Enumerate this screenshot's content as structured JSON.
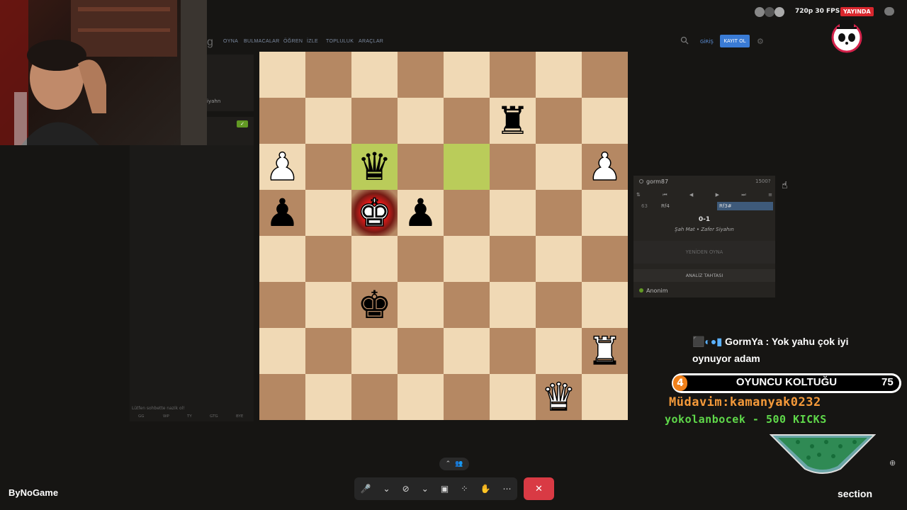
{
  "site": {
    "logo": "g",
    "nav": [
      "OYNA",
      "BULMACALAR",
      "ÖĞREN",
      "İZLE",
      "TOPLULUK",
      "ARAÇLAR"
    ],
    "login": "GİRİŞ",
    "signup": "KAYIT OL"
  },
  "left": {
    "partial_name": "iyahn",
    "chat_placeholder": "Lütfen sohbette nazik ol!",
    "chat_buttons": [
      "GG",
      "WP",
      "TY",
      "GTG",
      "BYE"
    ]
  },
  "board": {
    "squares": [
      [
        "",
        "",
        "",
        "",
        "",
        "",
        "",
        ""
      ],
      [
        "",
        "",
        "",
        "",
        "",
        "bR",
        "",
        ""
      ],
      [
        "wP",
        "",
        "bQ",
        "",
        "",
        "",
        "",
        "wP"
      ],
      [
        "bP",
        "",
        "wK",
        "bP",
        "",
        "",
        "",
        ""
      ],
      [
        "",
        "",
        "",
        "",
        "",
        "",
        "",
        ""
      ],
      [
        "",
        "",
        "bK",
        "",
        "",
        "",
        "",
        ""
      ],
      [
        "",
        "",
        "",
        "",
        "",
        "",
        "",
        "wR"
      ],
      [
        "",
        "",
        "",
        "",
        "",
        "",
        "wQ",
        ""
      ]
    ],
    "last_move_from": "r2c4",
    "last_move_to": "r2c2",
    "checked_square": "r3c2"
  },
  "game": {
    "player_top": "gorm87",
    "rating_top": "1500?",
    "move_number": "63",
    "move_white": "Rf4",
    "move_black": "Rf3#",
    "result": "0-1",
    "result_text": "Şah Mat • Zafer Siyahın",
    "rematch": "YENİDEN OYNA",
    "analysis": "ANALİZ TAHTASI",
    "player_bottom": "Anonim"
  },
  "stream": {
    "fps": "720p 30 FPS",
    "live": "YAYINDA",
    "chat_user": "GormYa",
    "chat_text": "GormYa : Yok yahu çok iyi oynuyor adam",
    "seat_number": "4",
    "seat_label": "OYUNCU KOLTUĞU",
    "seat_count": "75",
    "regular_viewer": "Müdavim:kamanyak0232",
    "kick_goal": "yokolanbocek - 500 KICKS",
    "brand_left": "ByNoGame",
    "brand_right": "section"
  },
  "icons": {
    "piece_glyphs": {
      "wK": "♚",
      "wQ": "♛",
      "wR": "♜",
      "wP": "♟",
      "bK": "♚",
      "bQ": "♛",
      "bR": "♜",
      "bP": "♟"
    }
  },
  "colors": {
    "light_square": "#f0d9b5",
    "dark_square": "#b58863",
    "highlight": "#bacc5a",
    "check": "#e21a1a",
    "live": "#d9272e",
    "hangup": "#d93a44"
  }
}
